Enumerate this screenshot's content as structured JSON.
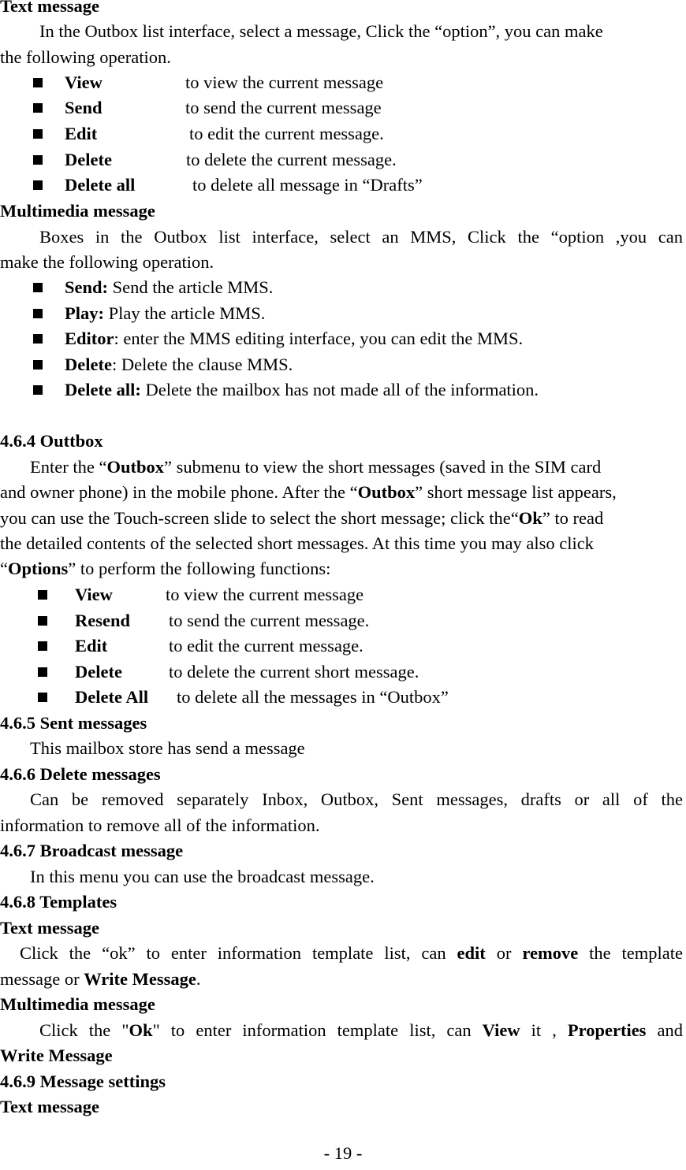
{
  "page": {
    "number": "- 19 -"
  },
  "drafts_section": {
    "text_message_heading": "Text message",
    "text_intro_line1": "In the Outbox list interface, select a message, Click the “option”, you can make",
    "text_intro_line2": "the following operation.",
    "text_items": [
      {
        "term": "View",
        "desc": "to view the current message"
      },
      {
        "term": "Send",
        "desc": "to send the current message"
      },
      {
        "term": "Edit",
        "desc": "to edit the current message."
      },
      {
        "term": "Delete",
        "desc": "to delete the current message."
      },
      {
        "term": "Delete all",
        "desc": "to delete all message in “Drafts”"
      }
    ],
    "mms_heading": "Multimedia message",
    "mms_intro_line1": "Boxes in the Outbox list interface, select an MMS, Click the “option ,you can",
    "mms_intro_line2": "make the following operation.",
    "mms_items": [
      {
        "term": "Send:",
        "desc": " Send the article MMS."
      },
      {
        "term": "Play:",
        "desc": " Play the article MMS."
      },
      {
        "term": "Editor",
        "desc": ": enter the MMS editing interface, you can edit the MMS."
      },
      {
        "term": "Delete",
        "desc": ": Delete the clause MMS."
      },
      {
        "term": "Delete all:",
        "desc": " Delete the mailbox has not made all of the information."
      }
    ]
  },
  "outbox_section": {
    "heading": "4.6.4 Outtbox",
    "p1_a": "Enter the “",
    "p1_b": "Outbox",
    "p1_c": "” submenu to view the short messages (saved in the SIM card",
    "p2_a": "and owner phone) in the mobile phone. After the “",
    "p2_b": "Outbox",
    "p2_c": "” short message list appears,",
    "p3_a": "you can use the Touch-screen slide to select the short message; click the“",
    "p3_b": "Ok",
    "p3_c": "” to read",
    "p4": "the detailed contents of the selected short messages. At this time you may also click",
    "p5_a": "“",
    "p5_b": "Options",
    "p5_c": "” to perform the following functions:",
    "items": [
      {
        "term": "View",
        "desc": "to view the current message"
      },
      {
        "term": "Resend",
        "desc": "to send the current message."
      },
      {
        "term": "Edit",
        "desc": "to edit the current message."
      },
      {
        "term": "Delete",
        "desc": "to delete the current short message."
      },
      {
        "term": "Delete All",
        "desc": "to delete all the messages in “Outbox”"
      }
    ]
  },
  "sent_section": {
    "heading": "4.6.5 Sent messages",
    "body": "This mailbox store has send a message"
  },
  "delete_section": {
    "heading": "4.6.6 Delete messages",
    "line1": "Can be removed separately Inbox, Outbox, Sent messages, drafts or all of the",
    "line2": "information to remove all of the information."
  },
  "broadcast_section": {
    "heading": "4.6.7 Broadcast message",
    "body": "In this menu you can use the broadcast message."
  },
  "templates_section": {
    "heading": "4.6.8 Templates",
    "text_heading": "Text message",
    "text_l1_a": "Click the “ok” to enter information template list, can ",
    "text_l1_b": "edit",
    "text_l1_c": " or ",
    "text_l1_d": "remove",
    "text_l1_e": " the template",
    "text_l2_a": "message or ",
    "text_l2_b": "Write Message",
    "text_l2_c": ".",
    "mms_heading": "Multimedia message",
    "mms_l1_a": "Click the \"",
    "mms_l1_b": "Ok",
    "mms_l1_c": "\" to enter information template list, can ",
    "mms_l1_d": "View",
    "mms_l1_e": " it , ",
    "mms_l1_f": "Properties",
    "mms_l1_g": " and",
    "mms_l2": "Write Message"
  },
  "settings_section": {
    "heading": "4.6.9 Message settings",
    "text_heading": "Text message"
  }
}
